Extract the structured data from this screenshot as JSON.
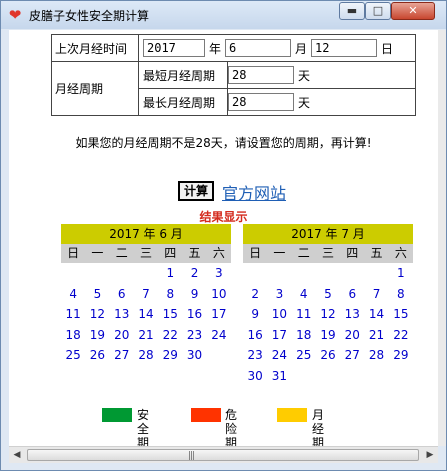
{
  "window": {
    "title": "皮膳子女性安全期计算",
    "min_glyph": "▬",
    "max_glyph": "□",
    "close_glyph": "✕",
    "icon_name": "heart-icon"
  },
  "form": {
    "last_label": "上次月经时间",
    "year_value": "2017",
    "year_unit": "年",
    "month_value": "6",
    "month_unit": "月",
    "day_value": "12",
    "day_unit": "日",
    "cycle_label": "月经周期",
    "shortest_label": "最短月经周期",
    "shortest_value": "28",
    "shortest_unit": "天",
    "longest_label": "最长月经周期",
    "longest_value": "28",
    "longest_unit": "天"
  },
  "message": "如果您的月经周期不是28天，请设置您的周期，再计算!",
  "calc_label": "计算",
  "site_link": "官方网站",
  "result_title": "结果显示",
  "weekdays": [
    "日",
    "一",
    "二",
    "三",
    "四",
    "五",
    "六"
  ],
  "calendars": [
    {
      "title": "2017 年  6 月",
      "days": [
        "",
        "",
        "",
        "",
        "1",
        "2",
        "3",
        "4",
        "5",
        "6",
        "7",
        "8",
        "9",
        "10",
        "11",
        "12",
        "13",
        "14",
        "15",
        "16",
        "17",
        "18",
        "19",
        "20",
        "21",
        "22",
        "23",
        "24",
        "25",
        "26",
        "27",
        "28",
        "29",
        "30"
      ]
    },
    {
      "title": "2017 年  7 月",
      "days": [
        "",
        "",
        "",
        "",
        "",
        "",
        "1",
        "2",
        "3",
        "4",
        "5",
        "6",
        "7",
        "8",
        "9",
        "10",
        "11",
        "12",
        "13",
        "14",
        "15",
        "16",
        "17",
        "18",
        "19",
        "20",
        "21",
        "22",
        "23",
        "24",
        "25",
        "26",
        "27",
        "28",
        "29",
        "30",
        "31"
      ]
    }
  ],
  "legend": [
    {
      "label": "安全期",
      "color": "#009933"
    },
    {
      "label": "危险期",
      "color": "#ff3300"
    },
    {
      "label": "月经期",
      "color": "#ffcc00"
    }
  ],
  "scrollbar": {
    "left_glyph": "◀",
    "right_glyph": "▶",
    "grip_glyph": "|||"
  }
}
